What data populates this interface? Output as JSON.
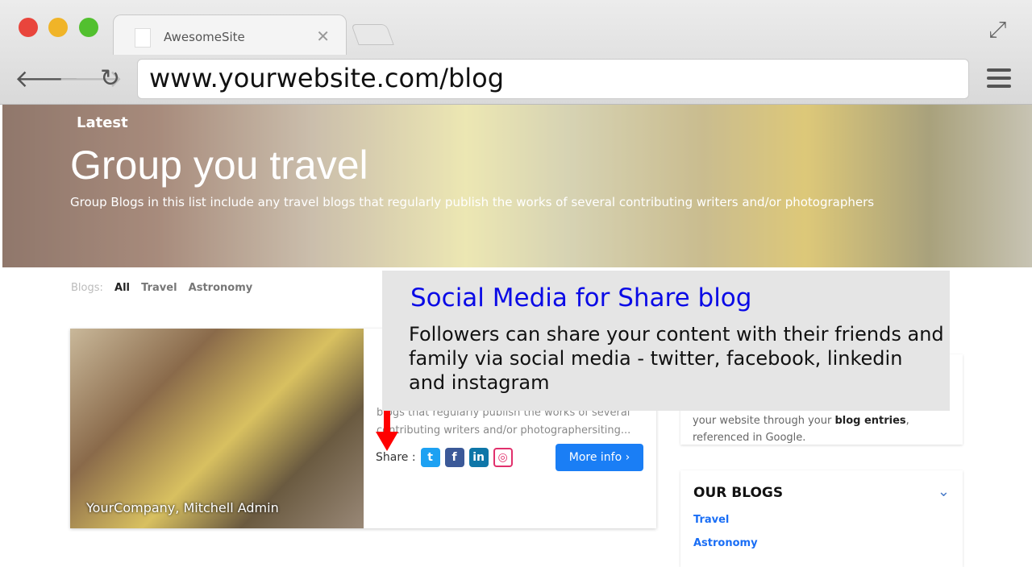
{
  "browser": {
    "tab_title": "AwesomeSite",
    "url": "www.yourwebsite.com/blog"
  },
  "hero": {
    "kicker": "Latest",
    "title": "Group you travel",
    "subtitle": "Group Blogs in this list include any travel blogs that regularly publish the works of several contributing writers and/or photographers"
  },
  "filters": {
    "label": "Blogs:",
    "items": [
      "All",
      "Travel",
      "Astronomy"
    ]
  },
  "post": {
    "author": "YourCompany, Mitchell Admin",
    "excerpt": "blogs that regularly publish the works of several contributing writers and/or photographersiting...",
    "share_label": "Share :",
    "more_label": "More info"
  },
  "share_icons": [
    {
      "name": "twitter",
      "color": "#1da1f2"
    },
    {
      "name": "facebook",
      "color": "#3b5998"
    },
    {
      "name": "linkedin",
      "color": "#0e76a8"
    },
    {
      "name": "instagram",
      "color": "#e1306c"
    }
  ],
  "sidebar": {
    "about_text_pre": "your website through your ",
    "about_bold": "blog entries",
    "about_text_post": ", referenced in Google.",
    "blogs_title": "OUR BLOGS",
    "blogs": [
      "Travel",
      "Astronomy"
    ]
  },
  "callout": {
    "title": "Social Media for Share blog",
    "body": "Followers can share your content with their friends and family via social media - twitter, facebook, linkedin and instagram"
  }
}
